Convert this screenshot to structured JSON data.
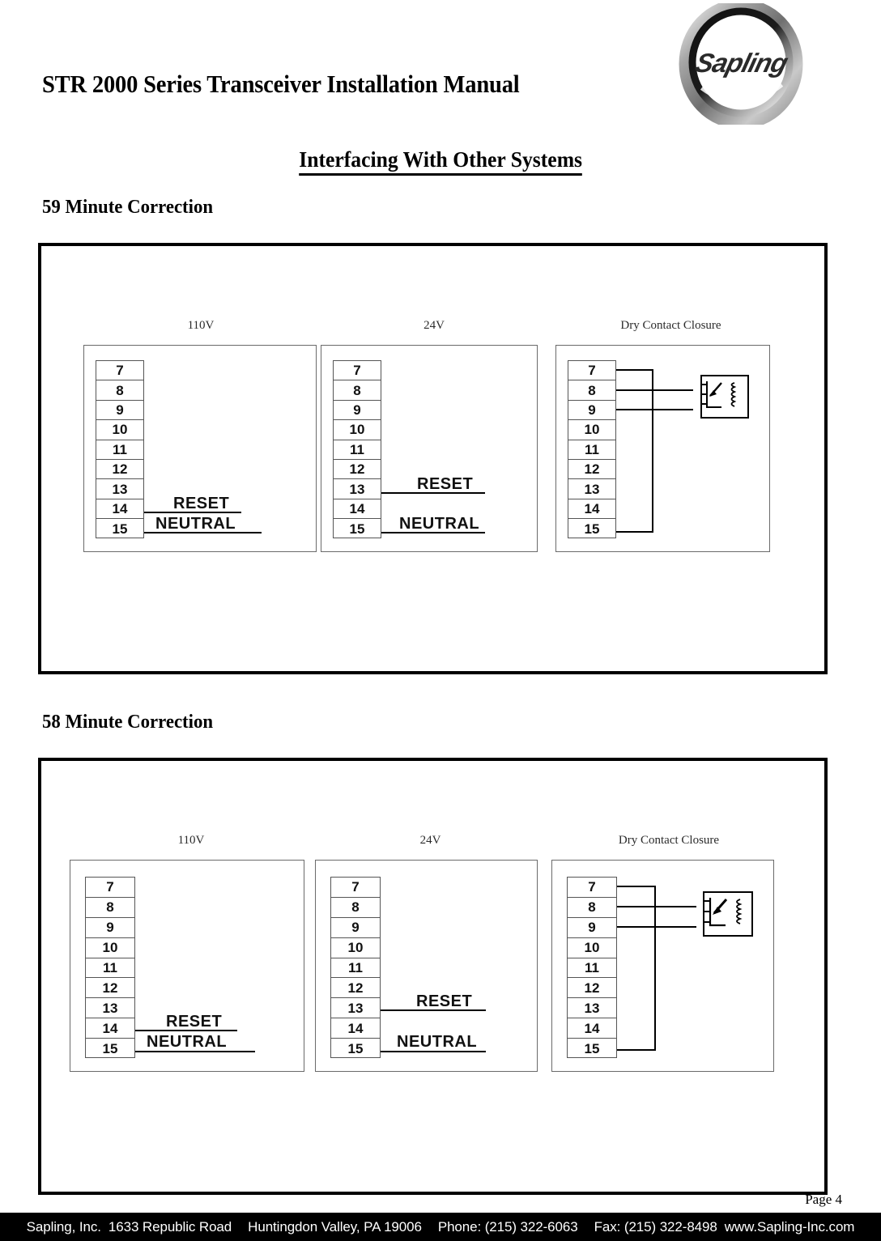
{
  "document": {
    "title": "STR 2000 Series Transceiver Installation Manual",
    "section_title": "Interfacing With Other Systems",
    "page_number": "Page 4",
    "logo_text": "Sapling"
  },
  "sections": [
    {
      "heading": "59 Minute Correction",
      "panels": [
        {
          "label": "110V",
          "terminals": [
            "7",
            "8",
            "9",
            "10",
            "11",
            "12",
            "13",
            "14",
            "15"
          ],
          "wires": [
            {
              "terminal": "14",
              "label": "RESET"
            },
            {
              "terminal": "15",
              "label": "NEUTRAL"
            }
          ],
          "has_relay": false
        },
        {
          "label": "24V",
          "terminals": [
            "7",
            "8",
            "9",
            "10",
            "11",
            "12",
            "13",
            "14",
            "15"
          ],
          "wires": [
            {
              "terminal": "13",
              "label": "RESET"
            },
            {
              "terminal": "15",
              "label": "NEUTRAL"
            }
          ],
          "has_relay": false
        },
        {
          "label": "Dry Contact Closure",
          "terminals": [
            "7",
            "8",
            "9",
            "10",
            "11",
            "12",
            "13",
            "14",
            "15"
          ],
          "wires": [],
          "has_relay": true,
          "relay_connections": [
            "7",
            "8",
            "9",
            "15"
          ]
        }
      ]
    },
    {
      "heading": "58 Minute Correction",
      "panels": [
        {
          "label": "110V",
          "terminals": [
            "7",
            "8",
            "9",
            "10",
            "11",
            "12",
            "13",
            "14",
            "15"
          ],
          "wires": [
            {
              "terminal": "14",
              "label": "RESET"
            },
            {
              "terminal": "15",
              "label": "NEUTRAL"
            }
          ],
          "has_relay": false
        },
        {
          "label": "24V",
          "terminals": [
            "7",
            "8",
            "9",
            "10",
            "11",
            "12",
            "13",
            "14",
            "15"
          ],
          "wires": [
            {
              "terminal": "13",
              "label": "RESET"
            },
            {
              "terminal": "15",
              "label": "NEUTRAL"
            }
          ],
          "has_relay": false
        },
        {
          "label": "Dry Contact Closure",
          "terminals": [
            "7",
            "8",
            "9",
            "10",
            "11",
            "12",
            "13",
            "14",
            "15"
          ],
          "wires": [],
          "has_relay": true,
          "relay_connections": [
            "7",
            "8",
            "9",
            "15"
          ]
        }
      ]
    }
  ],
  "footer": {
    "company": "Sapling, Inc.",
    "street": "1633 Republic Road",
    "city_state_zip": "Huntingdon Valley, PA 19006",
    "phone": "Phone: (215) 322-6063",
    "fax": "Fax: (215) 322-8498",
    "website": "www.Sapling-Inc.com"
  }
}
